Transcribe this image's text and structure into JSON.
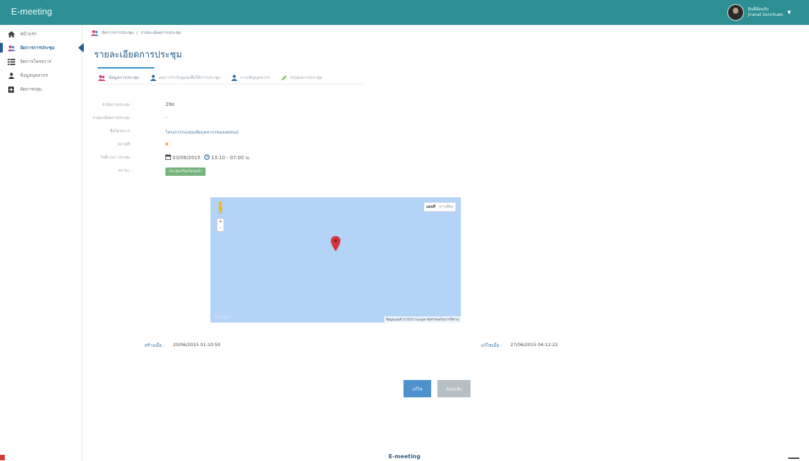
{
  "app": {
    "title": "E-meeting"
  },
  "user": {
    "line1": "ยินดีต้อนรับ",
    "line2": "jiranat Sonchuen"
  },
  "sidebar": {
    "items": [
      {
        "label": "หน้าแรก",
        "icon": "home-icon"
      },
      {
        "label": "จัดการการประชุม",
        "icon": "people-icon",
        "active": true
      },
      {
        "label": "จัดการโครงการ",
        "icon": "list-icon"
      },
      {
        "label": "ข้อมูลบุคลากร",
        "icon": "user-icon"
      },
      {
        "label": "จัดการกลุ่ม",
        "icon": "plus-box-icon"
      }
    ]
  },
  "breadcrumb": {
    "parent": "จัดการการประชุม",
    "separator": "/",
    "current": "รายละเอียดการประชุม"
  },
  "page": {
    "title": "รายละเอียดการประชุม"
  },
  "tabs": [
    {
      "label": "ข้อมูลการประชุม",
      "active": true
    },
    {
      "label": "ผลการกำกับดูแลเพื่อให้การประชุม",
      "active": false
    },
    {
      "label": "การเชิญบุคลากร",
      "active": false
    },
    {
      "label": "สรุปผลการประชุม",
      "active": false
    }
  ],
  "details": {
    "topic": {
      "label": "หัวข้อการประชุม :",
      "value": "29e"
    },
    "description": {
      "label": "รายละเอียดการประชุม :",
      "value": "-"
    },
    "project": {
      "label": "ชื่อโครงการ :",
      "value": "โครงการกองทุนเพิ่มบุคลากรของเคสหน2"
    },
    "location": {
      "label": "สถานที่ :"
    },
    "datetime": {
      "label": "วันที่-เวลา ประชุม :",
      "date": "03/06/2015",
      "time": "13:10 - 07:00 น."
    },
    "status": {
      "label": "สถานะ :",
      "value": "ประชุมเรียบร้อยแล้ว"
    }
  },
  "map": {
    "type_map": "แผนที่",
    "type_satellite": "ดาวเทียม",
    "zoom_in": "+",
    "zoom_out": "-",
    "logo": "Google",
    "credit": "ข้อมูลแผนที่ ©2015 Google   ข้อกำหนดในการใช้งาน",
    "pin_color": "#d9343c",
    "water_color": "#b4d4f7"
  },
  "meta": {
    "created_label": "สร้างเมื่อ :",
    "created_value": "20/06/2015 01:10:50",
    "modified_label": "แก้ไขเมื่อ :",
    "modified_value": "27/06/2015 04:12:22"
  },
  "buttons": {
    "edit": "แก้ไข",
    "cancel": "ย้อนกลับ"
  },
  "footer": {
    "text": "E-meeting"
  },
  "colors": {
    "topbar": "#2c8f93",
    "accent": "#2d6ea0",
    "edit_button": "#4e92cd",
    "status_badge": "#76b27c"
  }
}
